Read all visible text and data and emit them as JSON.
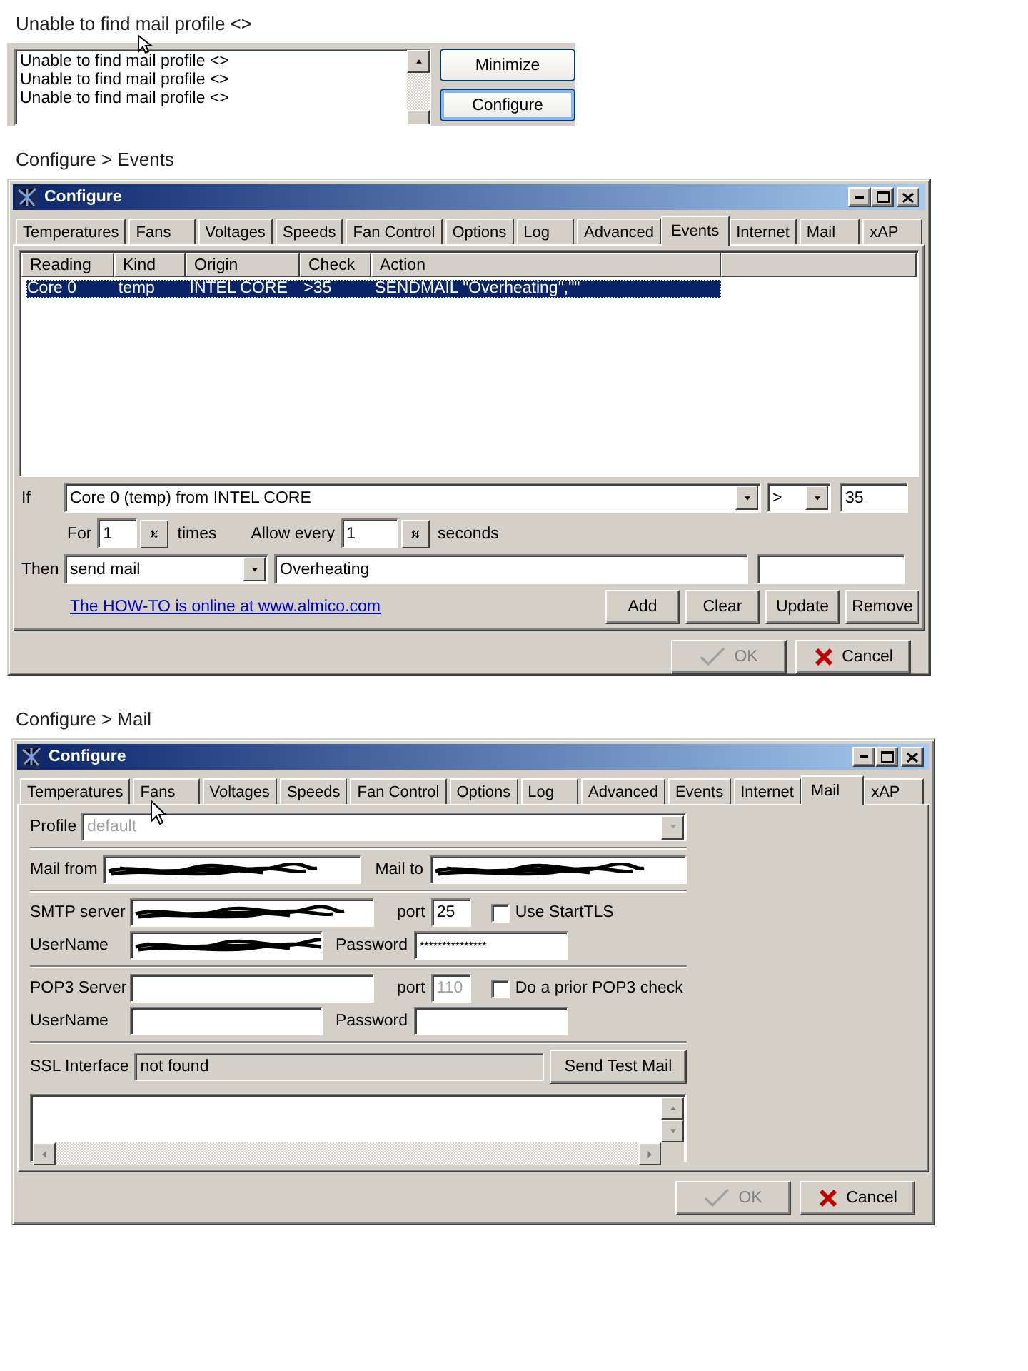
{
  "log_snippet": {
    "caption": "Unable to find mail profile <>",
    "lines": [
      "Unable to find mail profile <>",
      "Unable to find mail profile <>",
      "Unable to find mail profile <>"
    ],
    "buttons": [
      {
        "label": "Minimize",
        "focused": false
      },
      {
        "label": "Configure",
        "focused": true
      }
    ]
  },
  "events_window": {
    "caption": "Configure > Events",
    "title": "Configure",
    "tabs": [
      {
        "label": "Temperatures",
        "selected": false
      },
      {
        "label": "Fans",
        "selected": false
      },
      {
        "label": "Voltages",
        "selected": false
      },
      {
        "label": "Speeds",
        "selected": false
      },
      {
        "label": "Fan Control",
        "selected": false
      },
      {
        "label": "Options",
        "selected": false
      },
      {
        "label": "Log",
        "selected": false
      },
      {
        "label": "Advanced",
        "selected": false
      },
      {
        "label": "Events",
        "selected": true
      },
      {
        "label": "Internet",
        "selected": false
      },
      {
        "label": "Mail",
        "selected": false
      },
      {
        "label": "xAP",
        "selected": false
      }
    ],
    "table": {
      "columns": [
        "Reading",
        "Kind",
        "Origin",
        "Check",
        "Action"
      ],
      "rows": [
        {
          "cells": [
            "Core 0",
            "temp",
            "INTEL CORE",
            ">35",
            "SENDMAIL \"Overheating\",\"\""
          ],
          "selected": true
        }
      ]
    },
    "if_label": "If",
    "condition": "Core 0 (temp) from INTEL CORE",
    "operator": ">",
    "threshold": "35",
    "for_label": "For",
    "for_value": "1",
    "times_label": "times",
    "allow_label": "Allow every",
    "allow_value": "1",
    "seconds_label": "seconds",
    "then_label": "Then",
    "action": "send mail",
    "message": "Overheating",
    "link": "The HOW-TO is online at www.almico.com",
    "buttons": [
      "Add",
      "Clear",
      "Update",
      "Remove"
    ],
    "ok": {
      "label": "OK",
      "disabled": true
    },
    "cancel": "Cancel"
  },
  "mail_window": {
    "caption": "Configure > Mail",
    "title": "Configure",
    "tabs": [
      {
        "label": "Temperatures",
        "selected": false
      },
      {
        "label": "Fans",
        "selected": false
      },
      {
        "label": "Voltages",
        "selected": false
      },
      {
        "label": "Speeds",
        "selected": false
      },
      {
        "label": "Fan Control",
        "selected": false
      },
      {
        "label": "Options",
        "selected": false
      },
      {
        "label": "Log",
        "selected": false
      },
      {
        "label": "Advanced",
        "selected": false
      },
      {
        "label": "Events",
        "selected": false
      },
      {
        "label": "Internet",
        "selected": false
      },
      {
        "label": "Mail",
        "selected": true
      },
      {
        "label": "xAP",
        "selected": false
      }
    ],
    "profile": {
      "label": "Profile",
      "value": "default",
      "disabled": true
    },
    "mail_from": {
      "label": "Mail from",
      "redacted": true
    },
    "mail_to": {
      "label": "Mail to",
      "redacted": true
    },
    "smtp": {
      "server_label": "SMTP server",
      "server_redacted": true,
      "port_label": "port",
      "port": "25",
      "tls": {
        "label": "Use StartTLS",
        "checked": false
      },
      "user_label": "UserName",
      "user_redacted": true,
      "password_label": "Password",
      "password": "***************"
    },
    "pop3": {
      "server_label": "POP3 Server",
      "port_label": "port",
      "port": "110",
      "port_disabled": true,
      "check": {
        "label": "Do a prior POP3 check",
        "checked": false
      },
      "user_label": "UserName",
      "password_label": "Password"
    },
    "ssl": {
      "label": "SSL Interface",
      "value": "not found"
    },
    "test_button": "Send Test Mail",
    "ok": {
      "label": "OK",
      "disabled": true
    },
    "cancel": "Cancel"
  }
}
